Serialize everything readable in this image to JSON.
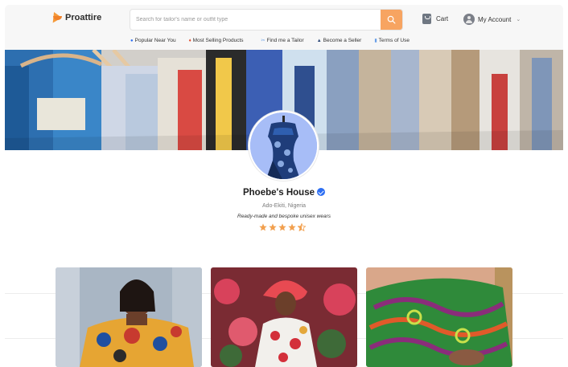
{
  "header": {
    "logo_text": "Proattire",
    "search_placeholder": "Search for tailor's name or outfit type",
    "cart_label": "Cart",
    "account_label": "My Account"
  },
  "nav": {
    "items": [
      {
        "label": "Popular Near You",
        "icon": "location-pin-icon"
      },
      {
        "label": "Most Selling Products",
        "icon": "fire-icon"
      },
      {
        "label": "Find me a Tailor",
        "icon": "scissors-icon"
      },
      {
        "label": "Become a Seller",
        "icon": "graduation-cap-icon"
      },
      {
        "label": "Terms of Use",
        "icon": "document-icon"
      }
    ]
  },
  "profile": {
    "shop_name": "Phoebe's House",
    "verified": true,
    "location": "Ado-Ekiti, Nigeria",
    "tagline": "Ready-made and bespoke unisex wears",
    "rating": 4.5
  },
  "colors": {
    "accent": "#f7a461",
    "star": "#f2a04e",
    "verified": "#2e6ff2",
    "avatar_bg": "#a7bdf7"
  }
}
